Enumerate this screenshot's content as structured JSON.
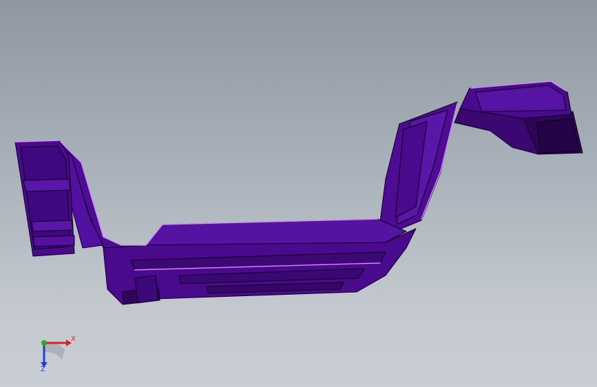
{
  "viewport": {
    "background_top": "#8f98a2",
    "background_bottom": "#c9ced4"
  },
  "model": {
    "face_color": "#4a0a8e",
    "face_dark": "#2d0557",
    "face_light": "#6a1fc0",
    "edge_color": "#0b0016",
    "highlight_color": "#d58cff"
  },
  "triad": {
    "x_label": "X",
    "z_label": "Z",
    "x_color": "#e02020",
    "y_color": "#20b020",
    "z_color": "#2040d0"
  }
}
